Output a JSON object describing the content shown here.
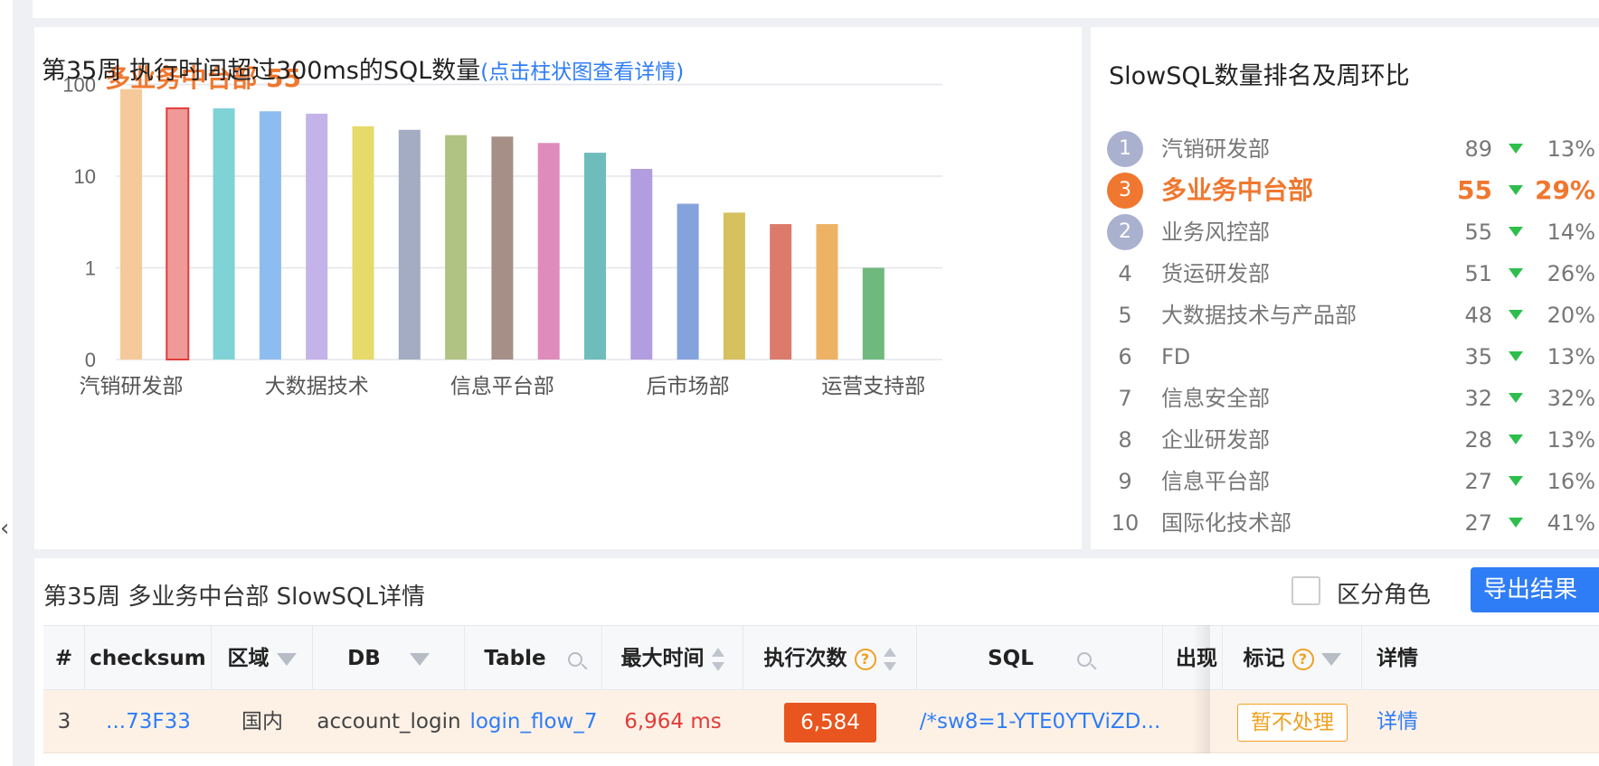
{
  "chart_panel": {
    "title": "第35周 执行时间超过300ms的SQL数量",
    "subtitle": "(点击柱状图查看详情)"
  },
  "chart_data": {
    "type": "bar",
    "scale": "log",
    "y_ticks": [
      "0",
      "1",
      "10",
      "100"
    ],
    "x_tick_labels": [
      "汽销研发部",
      "大数据技术",
      "信息平台部",
      "后市场部",
      "运营支持部"
    ],
    "values": [
      89,
      55,
      55,
      51,
      48,
      35,
      32,
      28,
      27,
      23,
      18,
      12,
      5,
      4,
      3,
      3,
      1
    ],
    "colors": [
      "#f6c99a",
      "#ef9a98",
      "#7fd3d6",
      "#8dbdf0",
      "#c3b3e8",
      "#e6da6a",
      "#a3acc3",
      "#b0c383",
      "#a58f87",
      "#df8bbb",
      "#6fbcbc",
      "#b19ddf",
      "#84a3dd",
      "#d6c15e",
      "#dc7a6b",
      "#edb263",
      "#6fb87e",
      "#7bcdee"
    ],
    "highlight_index": 1,
    "highlight_label": "多业务中台部 55",
    "grid": true
  },
  "ranking": {
    "title": "SlowSQL数量排名及周环比",
    "items": [
      {
        "rank": "1",
        "name": "汽销研发部",
        "count": "89",
        "pct": "13%"
      },
      {
        "rank": "3",
        "name": "多业务中台部",
        "count": "55",
        "pct": "29%"
      },
      {
        "rank": "2",
        "name": "业务风控部",
        "count": "55",
        "pct": "14%"
      },
      {
        "rank": "4",
        "name": "货运研发部",
        "count": "51",
        "pct": "26%"
      },
      {
        "rank": "5",
        "name": "大数据技术与产品部",
        "count": "48",
        "pct": "20%"
      },
      {
        "rank": "6",
        "name": "FD",
        "count": "35",
        "pct": "13%"
      },
      {
        "rank": "7",
        "name": "信息安全部",
        "count": "32",
        "pct": "32%"
      },
      {
        "rank": "8",
        "name": "企业研发部",
        "count": "28",
        "pct": "13%"
      },
      {
        "rank": "9",
        "name": "信息平台部",
        "count": "27",
        "pct": "16%"
      },
      {
        "rank": "10",
        "name": "国际化技术部",
        "count": "27",
        "pct": "41%"
      }
    ]
  },
  "detail": {
    "title": "第35周 多业务中台部 SlowSQL详情",
    "role_label": "区分角色",
    "export_label": "导出结果",
    "columns": {
      "index": "#",
      "checksum": "checksum",
      "region": "区域",
      "db": "DB",
      "table": "Table",
      "max_time": "最大时间",
      "exec_count": "执行次数",
      "sql": "SQL",
      "appear": "出现",
      "mark": "标记",
      "detail": "详情"
    },
    "row": {
      "index": "3",
      "checksum": "...73F33",
      "region": "国内",
      "db": "account_login",
      "table": "login_flow_7",
      "max_time": "6,964 ms",
      "exec_count": "6,584",
      "sql": "/*sw8=1-YTE0YTViZD...",
      "mark": "暂不处理",
      "detail": "详情"
    }
  }
}
